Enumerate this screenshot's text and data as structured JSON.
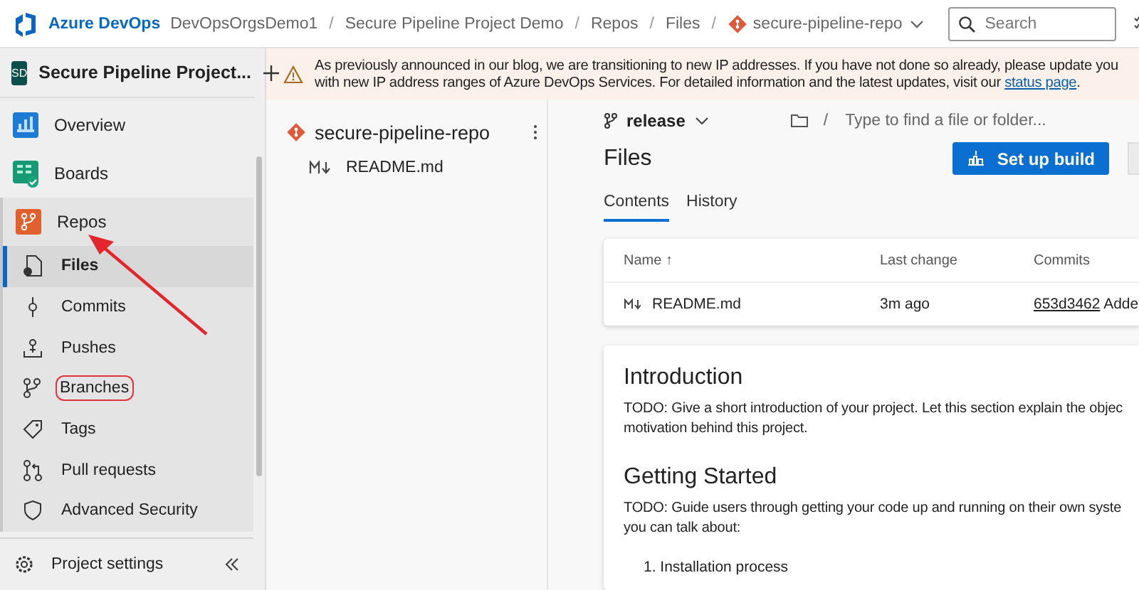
{
  "top_bar": {
    "product": "Azure DevOps",
    "separator": "/",
    "breadcrumbs": [
      {
        "text": "DevOpsOrgsDemo1"
      },
      {
        "text": "Secure Pipeline Project Demo"
      },
      {
        "text": "Repos"
      },
      {
        "text": "Files"
      },
      {
        "text": "secure-pipeline-repo",
        "kind": "repo"
      }
    ],
    "search": {
      "placeholder": "Search"
    }
  },
  "sidebar": {
    "project": {
      "initials": "SD",
      "name": "Secure Pipeline Project..."
    },
    "items": [
      {
        "label": "Overview",
        "selected": false,
        "highlighted": false
      },
      {
        "label": "Boards",
        "selected": false,
        "highlighted": false
      },
      {
        "label": "Repos",
        "selected": false,
        "highlighted": false,
        "expanded": true,
        "children": [
          {
            "label": "Files",
            "selected": true,
            "highlighted": false
          },
          {
            "label": "Commits",
            "selected": false,
            "highlighted": false
          },
          {
            "label": "Pushes",
            "selected": false,
            "highlighted": false
          },
          {
            "label": "Branches",
            "selected": false,
            "highlighted": true
          },
          {
            "label": "Tags",
            "selected": false,
            "highlighted": false
          },
          {
            "label": "Pull requests",
            "selected": false,
            "highlighted": false
          },
          {
            "label": "Advanced Security",
            "selected": false,
            "highlighted": false
          }
        ]
      }
    ],
    "footer": {
      "label": "Project settings"
    }
  },
  "annotation": {
    "kind": "arrow"
  },
  "banner": {
    "lines": [
      {
        "text": "As previously announced in our blog, we are transitioning to new IP addresses. If you have not done so already, please update you"
      },
      {
        "text": "with new IP address ranges of Azure DevOps Services. For detailed information and the latest updates, visit our",
        "link": "status page",
        "tail": "."
      }
    ]
  },
  "repo_panel": {
    "title": "secure-pipeline-repo",
    "files": [
      {
        "name": "README.md"
      }
    ]
  },
  "files": {
    "branch": "release",
    "path_placeholder": "Type to find a file or folder...",
    "path_separator": "/",
    "title": "Files",
    "setup_button": "Set up build",
    "tabs": [
      {
        "label": "Contents",
        "selected": true
      },
      {
        "label": "History",
        "selected": false
      }
    ],
    "table": {
      "columns": [
        "Name ↑",
        "Last change",
        "Commits"
      ],
      "rows": [
        {
          "name": "README.md",
          "last_change": "3m ago",
          "commit": "653d3462",
          "message": "Adde"
        }
      ]
    },
    "readme": [
      {
        "kind": "heading",
        "text": "Introduction"
      },
      {
        "kind": "paragraph",
        "lines": [
          "TODO: Give a short introduction of your project. Let this section explain the objec",
          "motivation behind this project."
        ]
      },
      {
        "kind": "heading",
        "text": "Getting Started"
      },
      {
        "kind": "paragraph",
        "lines": [
          "TODO: Guide users through getting your code up and running on their own syste",
          "you can talk about:"
        ]
      },
      {
        "kind": "list_item",
        "text": "1. Installation process"
      }
    ]
  }
}
